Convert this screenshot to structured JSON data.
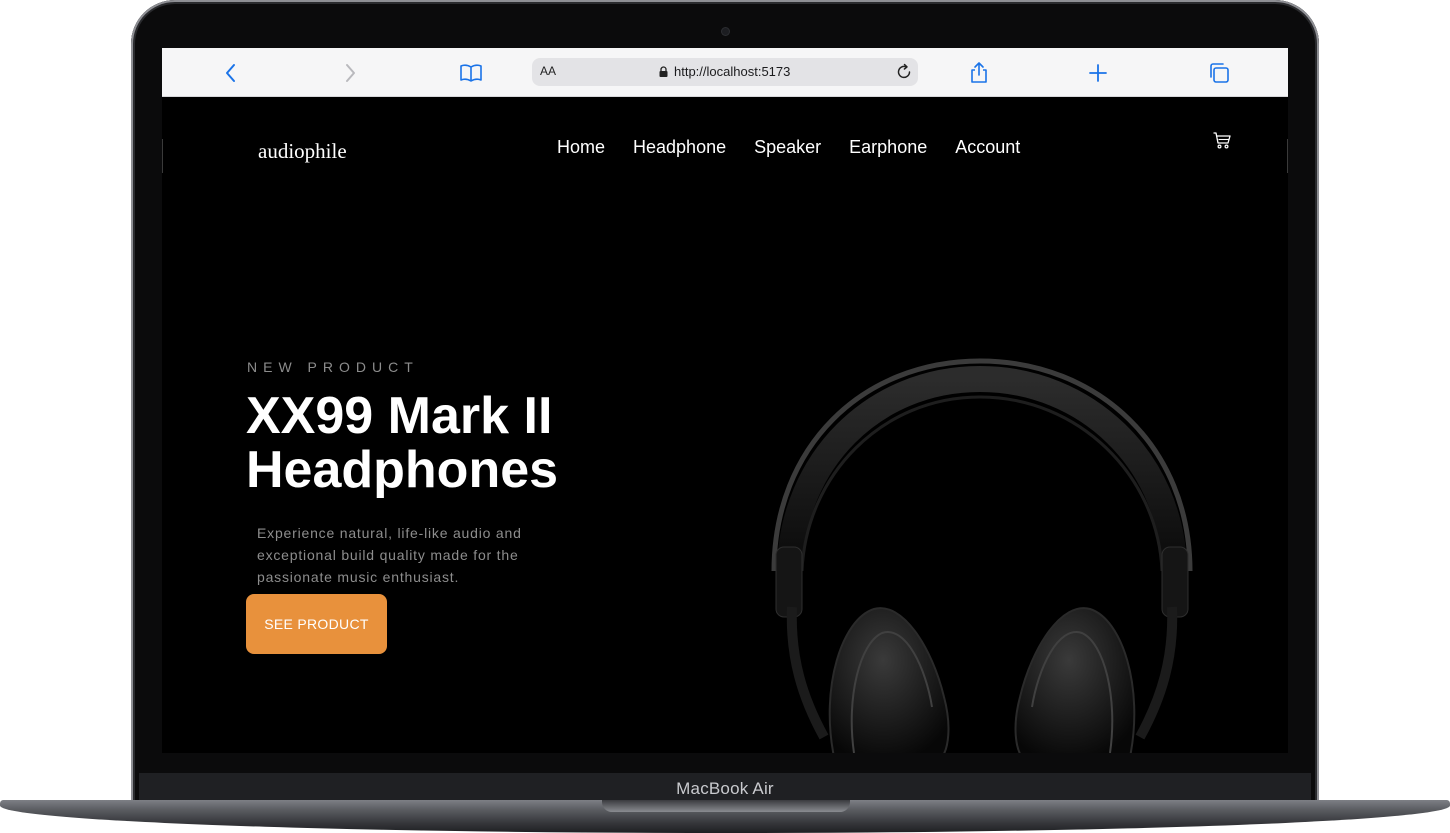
{
  "device": {
    "label": "MacBook Air"
  },
  "browser": {
    "reader_label": "AA",
    "url": "http://localhost:5173",
    "icons": {
      "back": "chevron-left-icon",
      "forward": "chevron-right-icon",
      "bookmarks": "book-icon",
      "lock": "lock-icon",
      "reload": "reload-icon",
      "share": "share-icon",
      "new_tab": "plus-icon",
      "tabs": "tabs-icon"
    },
    "accent": "#1a73e8"
  },
  "site": {
    "logo": "audiophile",
    "nav": [
      {
        "label": "Home"
      },
      {
        "label": "Headphone"
      },
      {
        "label": "Speaker"
      },
      {
        "label": "Earphone"
      },
      {
        "label": "Account"
      }
    ],
    "cart_icon": "cart-icon"
  },
  "hero": {
    "eyebrow": "NEW PRODUCT",
    "title": "XX99 Mark II Headphones",
    "description": "Experience natural, life-like audio and exceptional build quality made for the passionate music enthusiast.",
    "cta_label": "SEE PRODUCT",
    "cta_color": "#e8913c",
    "image": "headphones-image"
  }
}
